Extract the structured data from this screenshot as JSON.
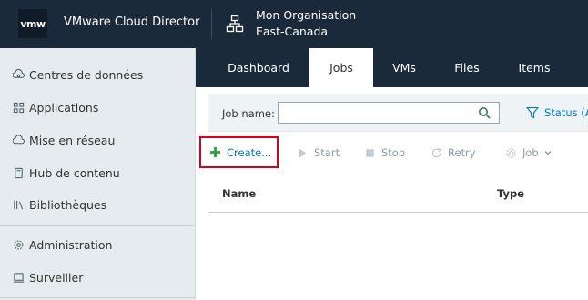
{
  "header": {
    "logo_text": "vmw",
    "app_title": "VMware Cloud Director",
    "org_name": "Mon Organisation",
    "org_location": "East-Canada",
    "org_icon": "org-tree-icon"
  },
  "sidebar": {
    "items": [
      {
        "label": "Centres de données",
        "icon": "datacenter-icon"
      },
      {
        "label": "Applications",
        "icon": "applications-grid-icon"
      },
      {
        "label": "Mise en réseau",
        "icon": "cloud-network-icon"
      },
      {
        "label": "Hub de contenu",
        "icon": "content-hub-icon"
      },
      {
        "label": "Bibliothèques",
        "icon": "libraries-icon"
      },
      {
        "label": "Administration",
        "icon": "gear-icon"
      },
      {
        "label": "Surveiller",
        "icon": "monitor-icon"
      }
    ]
  },
  "tabs": [
    {
      "label": "Dashboard",
      "active": false
    },
    {
      "label": "Jobs",
      "active": true
    },
    {
      "label": "VMs",
      "active": false
    },
    {
      "label": "Files",
      "active": false
    },
    {
      "label": "Items",
      "active": false
    }
  ],
  "filter": {
    "job_name_label": "Job name:",
    "job_name_value": "",
    "status_label": "Status (A"
  },
  "toolbar": {
    "create": "Create...",
    "start": "Start",
    "stop": "Stop",
    "retry": "Retry",
    "job": "Job"
  },
  "grid": {
    "columns": [
      "Name",
      "Type"
    ]
  },
  "colors": {
    "header_bg": "#1b2a3a",
    "sidebar_bg": "#e5ebee",
    "link_blue": "#0079b8",
    "create_plus_green": "#2e9e3f",
    "highlight_red": "#d8001c",
    "disabled_gray": "#8c9aa3"
  }
}
